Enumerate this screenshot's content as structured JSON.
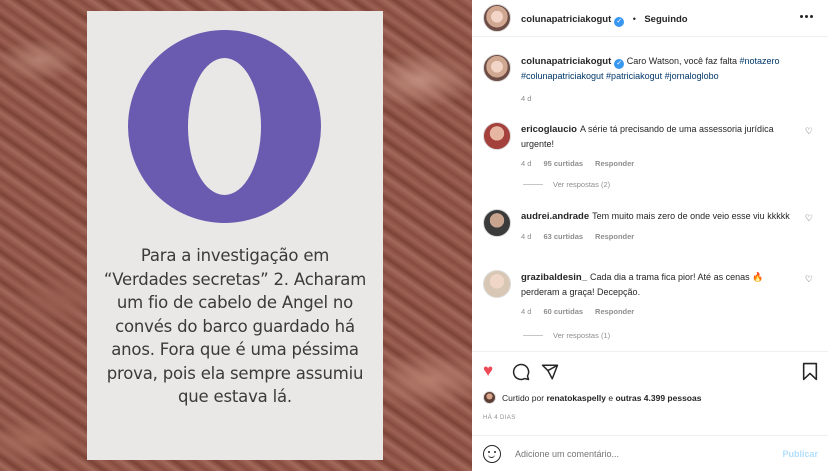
{
  "post_image": {
    "logo_letter": "O",
    "card_text": "Para a investigação em “Verdades secretas” 2. Acharam um fio de cabelo de Angel no convés do barco guardado há anos. Fora que é uma péssima prova, pois ela sempre assumiu que estava lá."
  },
  "header": {
    "username": "colunapatriciakogut",
    "separator": "•",
    "follow_status": "Seguindo"
  },
  "caption": {
    "username": "colunapatriciakogut",
    "text": "Caro Watson, você faz falta",
    "hashtags": "#notazero #colunapatriciakogut #patriciakogut #jornaloglobo",
    "time": "4 d"
  },
  "comments": [
    {
      "username": "ericoglaucio",
      "text": "A série tá precisando de uma assessoria jurídica urgente!",
      "time": "4 d",
      "likes": "95 curtidas",
      "reply": "Responder",
      "view_replies": "Ver respostas (2)"
    },
    {
      "username": "audrei.andrade",
      "text": "Tem muito mais zero de onde veio esse viu kkkkk",
      "time": "4 d",
      "likes": "63 curtidas",
      "reply": "Responder"
    },
    {
      "username": "grazibaldesin_",
      "text": "Cada dia a trama fica pior! Até as cenas 🔥 perderam a graça! Decepção.",
      "time": "4 d",
      "likes": "60 curtidas",
      "reply": "Responder",
      "view_replies": "Ver respostas (1)"
    }
  ],
  "likes": {
    "prefix": "Curtido por",
    "user": "renatokaspelly",
    "connector": "e",
    "others": "outras 4.399 pessoas"
  },
  "post_time": "HÁ 4 DIAS",
  "add_comment": {
    "placeholder": "Adicione um comentário...",
    "post_label": "Publicar"
  },
  "colors": {
    "accent_link": "#00376b",
    "like_red": "#ed4956",
    "verified_blue": "#3897f0",
    "logo_purple": "#6a5bb0"
  }
}
